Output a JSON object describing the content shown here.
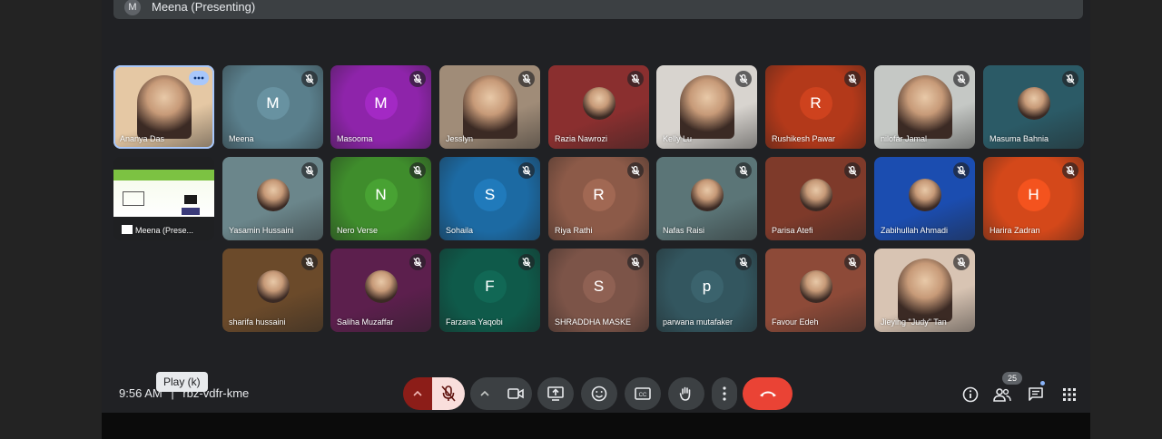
{
  "presenting_banner": {
    "avatar_letter": "M",
    "text": "Meena (Presenting)"
  },
  "participants": [
    {
      "name": "Ananya Das",
      "kind": "photo",
      "color": "#e5c8a4"
    },
    {
      "name": "Meena",
      "kind": "letter",
      "letter": "M",
      "color": "#5a7f8c"
    },
    {
      "name": "Masooma",
      "kind": "letter",
      "letter": "M",
      "color": "#8e24aa"
    },
    {
      "name": "Jesslyn",
      "kind": "photo",
      "color": "#a08c78"
    },
    {
      "name": "Razia Nawrozi",
      "kind": "photo",
      "color": "#8a2f2f"
    },
    {
      "name": "Kelly Lu",
      "kind": "photo",
      "color": "#d8d4cf"
    },
    {
      "name": "Rushikesh Pawar",
      "kind": "letter",
      "letter": "R",
      "color": "#b3391a"
    },
    {
      "name": "nilofar Jamal",
      "kind": "photo",
      "color": "#c5c8c5"
    },
    {
      "name": "Masuma Bahnia",
      "kind": "photo",
      "color": "#2b5a66"
    },
    {
      "name": "Meena (Prese...",
      "kind": "screen",
      "color": "#ffffff"
    },
    {
      "name": "Yasamin Hussaini",
      "kind": "photo",
      "color": "#6b868b"
    },
    {
      "name": "Nero Verse",
      "kind": "letter",
      "letter": "N",
      "color": "#3f8d2c"
    },
    {
      "name": "Sohaila",
      "kind": "letter",
      "letter": "S",
      "color": "#1c6aa3"
    },
    {
      "name": "Riya Rathi",
      "kind": "letter",
      "letter": "R",
      "color": "#8c5a48"
    },
    {
      "name": "Nafas Raisi",
      "kind": "photo",
      "color": "#5b7577"
    },
    {
      "name": "Parisa Atefi",
      "kind": "photo",
      "color": "#7e3a2a"
    },
    {
      "name": "Zabihullah Ahmadi",
      "kind": "photo",
      "color": "#1b4db0"
    },
    {
      "name": "Harira Zadran",
      "kind": "letter",
      "letter": "H",
      "color": "#d4481a"
    },
    {
      "name": "sharifa hussaini",
      "kind": "photo",
      "color": "#6b4a2a"
    },
    {
      "name": "Saliha Muzaffar",
      "kind": "photo",
      "color": "#5c1f4d"
    },
    {
      "name": "Farzana Yaqobi",
      "kind": "letter",
      "letter": "F",
      "color": "#0f5a4a"
    },
    {
      "name": "SHRADDHA MASKE",
      "kind": "letter",
      "letter": "S",
      "color": "#7c5448"
    },
    {
      "name": "parwana mutafaker",
      "kind": "letter",
      "letter": "p",
      "color": "#33565f"
    },
    {
      "name": "Favour Edeh",
      "kind": "photo",
      "color": "#8d4a38"
    },
    {
      "name": "Jieying \"Judy\" Tan",
      "kind": "photo",
      "color": "#d8c4b3"
    }
  ],
  "controls": {
    "time": "9:56 AM",
    "separator": "|",
    "meeting_code": "rbz-vdfr-kme",
    "tooltip": "Play (k)",
    "participant_count": "25"
  },
  "icons": {
    "mic": "mic-off-icon",
    "camera": "videocam-icon",
    "present": "present-screen-icon",
    "emoji": "emoji-icon",
    "captions": "closed-caption-icon",
    "hand": "raise-hand-icon",
    "more": "more-vert-icon",
    "end": "call-end-icon",
    "info": "info-icon",
    "people": "people-icon",
    "chat": "chat-icon",
    "activities": "apps-grid-icon"
  },
  "colors": {
    "background": "#202124",
    "end_call": "#ea4335",
    "mic_muted": "#f9dedc",
    "mic_muted_group": "#8c1d18",
    "accent": "#a8c7fa"
  }
}
